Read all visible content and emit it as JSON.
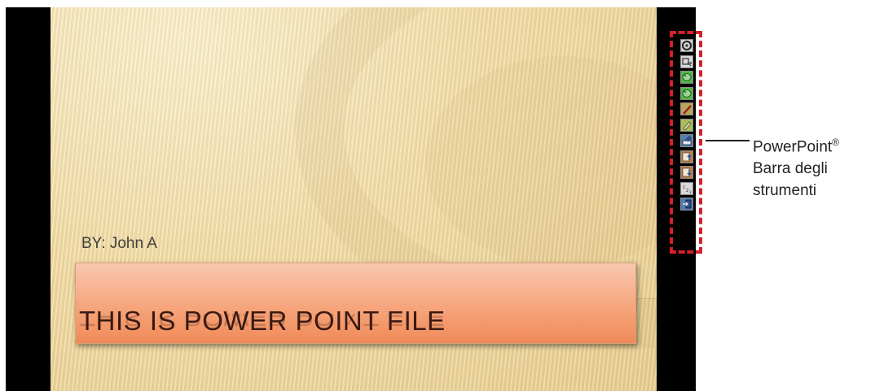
{
  "slide": {
    "byline": "BY: John A",
    "title": "THIS IS POWER POINT FILE"
  },
  "toolbar": {
    "buttons": [
      {
        "name": "zoom-icon",
        "bg": "#d0d0d0"
      },
      {
        "name": "pointer-options-icon",
        "bg": "#d8d8d8"
      },
      {
        "name": "previous-slide-icon",
        "bg": "#52b848"
      },
      {
        "name": "next-slide-icon",
        "bg": "#52b848"
      },
      {
        "name": "pen-icon",
        "bg": "#b9a45a"
      },
      {
        "name": "highlighter-icon",
        "bg": "#a8bd5a"
      },
      {
        "name": "eraser-icon",
        "bg": "#4f7fb8"
      },
      {
        "name": "page-up-icon",
        "bg": "#b97c4b"
      },
      {
        "name": "page-down-icon",
        "bg": "#b97c4b"
      },
      {
        "name": "slide-number-icon",
        "bg": "#d8d8d8"
      },
      {
        "name": "exit-icon",
        "bg": "#4f7fb8"
      }
    ]
  },
  "callout": {
    "line1": "PowerPoint",
    "sup": "®",
    "line2": "Barra degli",
    "line3": "strumenti"
  },
  "colors": {
    "dashed_border": "#d6202a",
    "title_box": "#f6a57c"
  }
}
